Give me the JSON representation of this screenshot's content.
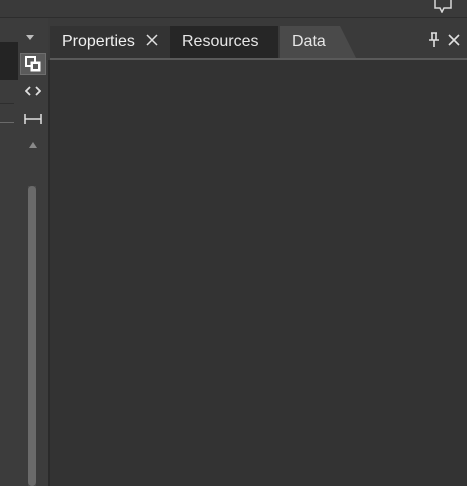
{
  "icons": {
    "feedback": "speech-bubble-icon",
    "dropdown": "chevron-down-icon",
    "tool1": "layers-icon",
    "tool2": "code-brackets-icon",
    "tool3": "width-measure-icon",
    "scroll_up": "triangle-up-icon",
    "pin": "pin-icon",
    "close": "close-icon"
  },
  "panel": {
    "tabs": [
      {
        "label": "Properties",
        "active": true,
        "closable": true
      },
      {
        "label": "Resources",
        "active": false,
        "closable": false
      },
      {
        "label": "Data",
        "active": false,
        "closable": false
      }
    ]
  },
  "colors": {
    "background": "#3a3a3a",
    "active_tab": "#333333",
    "inactive_tab": "#262626",
    "content": "#333333",
    "text": "#e6e6e6"
  }
}
